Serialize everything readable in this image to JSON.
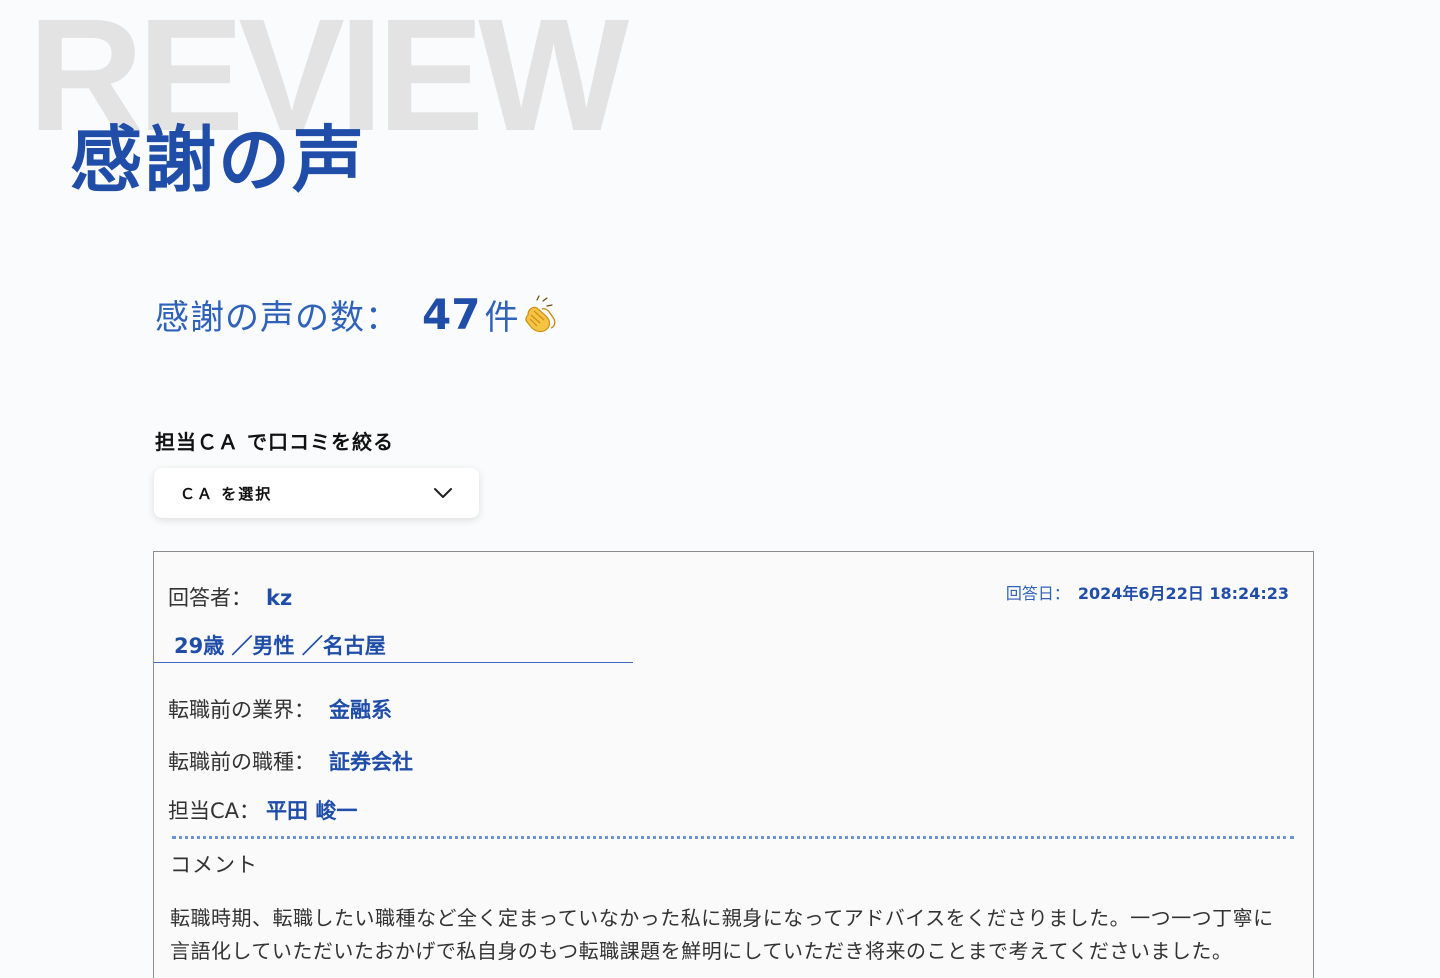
{
  "hero": {
    "background_word": "REVIEW",
    "title": "感謝の声"
  },
  "summary": {
    "label": "感謝の声の数：",
    "count": "47",
    "unit": "件",
    "icon": "clapping-hands-icon"
  },
  "filter": {
    "label": "担当ＣＡ で口コミを絞る",
    "select_value": "ＣＡ を選択",
    "icon": "chevron-down-icon"
  },
  "review": {
    "respondent_label": "回答者：",
    "respondent_name": "kz",
    "date_label": "回答日：",
    "date_value": "2024年6月22日 18:24:23",
    "profile": "29歳 ／男性 ／名古屋",
    "industry_label": "転職前の業界：",
    "industry_value": "金融系",
    "jobtype_label": "転職前の職種：",
    "jobtype_value": "証券会社",
    "ca_label": "担当CA：",
    "ca_value": "平田 峻一",
    "comment_heading": "コメント",
    "comment_text": "転職時期、転職したい職種など全く定まっていなかった私に親身になってアドバイスをくださりました。一つ一つ丁寧に言語化していただいたおかげで私自身のもつ転職課題を鮮明にしていただき将来のことまで考えてくださいました。"
  },
  "colors": {
    "accent": "#1f4da8",
    "background": "#fafbfc",
    "watermark": "#e3e3e3"
  }
}
